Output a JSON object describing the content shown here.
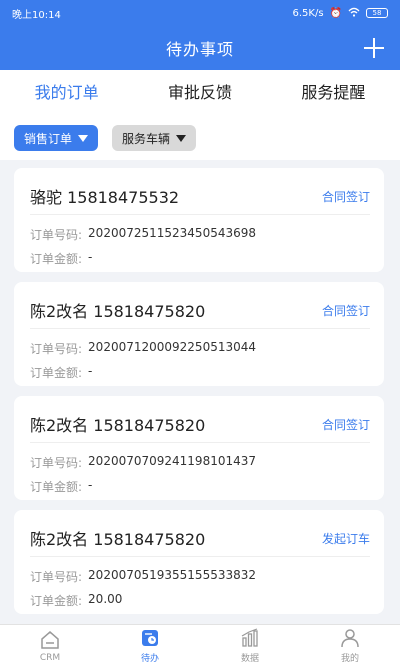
{
  "status_bar": {
    "time": "晚上10:14",
    "speed": "6.5K/s",
    "battery": "58"
  },
  "header": {
    "title": "待办事项"
  },
  "tabs": [
    {
      "label": "我的订单",
      "active": true
    },
    {
      "label": "审批反馈",
      "active": false
    },
    {
      "label": "服务提醒",
      "active": false
    }
  ],
  "filters": {
    "sales_order": "销售订单",
    "service_vehicle": "服务车辆"
  },
  "orders": [
    {
      "name": "骆驼 15818475532",
      "action": "合同签订",
      "order_no_label": "订单号码:",
      "order_no": "2020072511523450543698",
      "amount_label": "订单金额:",
      "amount": "-"
    },
    {
      "name": "陈2改名 15818475820",
      "action": "合同签订",
      "order_no_label": "订单号码:",
      "order_no": "2020071200092250513044",
      "amount_label": "订单金额:",
      "amount": "-"
    },
    {
      "name": "陈2改名 15818475820",
      "action": "合同签订",
      "order_no_label": "订单号码:",
      "order_no": "2020070709241198101437",
      "amount_label": "订单金额:",
      "amount": "-"
    },
    {
      "name": "陈2改名 15818475820",
      "action": "发起订车",
      "order_no_label": "订单号码:",
      "order_no": "2020070519355155533832",
      "amount_label": "订单金额:",
      "amount": "20.00"
    }
  ],
  "tabbar": [
    {
      "label": "CRM",
      "icon": "home-icon",
      "active": false
    },
    {
      "label": "待办",
      "icon": "todo-icon",
      "active": true
    },
    {
      "label": "数据",
      "icon": "chart-icon",
      "active": false
    },
    {
      "label": "我的",
      "icon": "user-icon",
      "active": false
    }
  ],
  "colors": {
    "primary": "#3b7cec",
    "chip_gray": "#d9d9d9",
    "background": "#f1f3f7"
  }
}
